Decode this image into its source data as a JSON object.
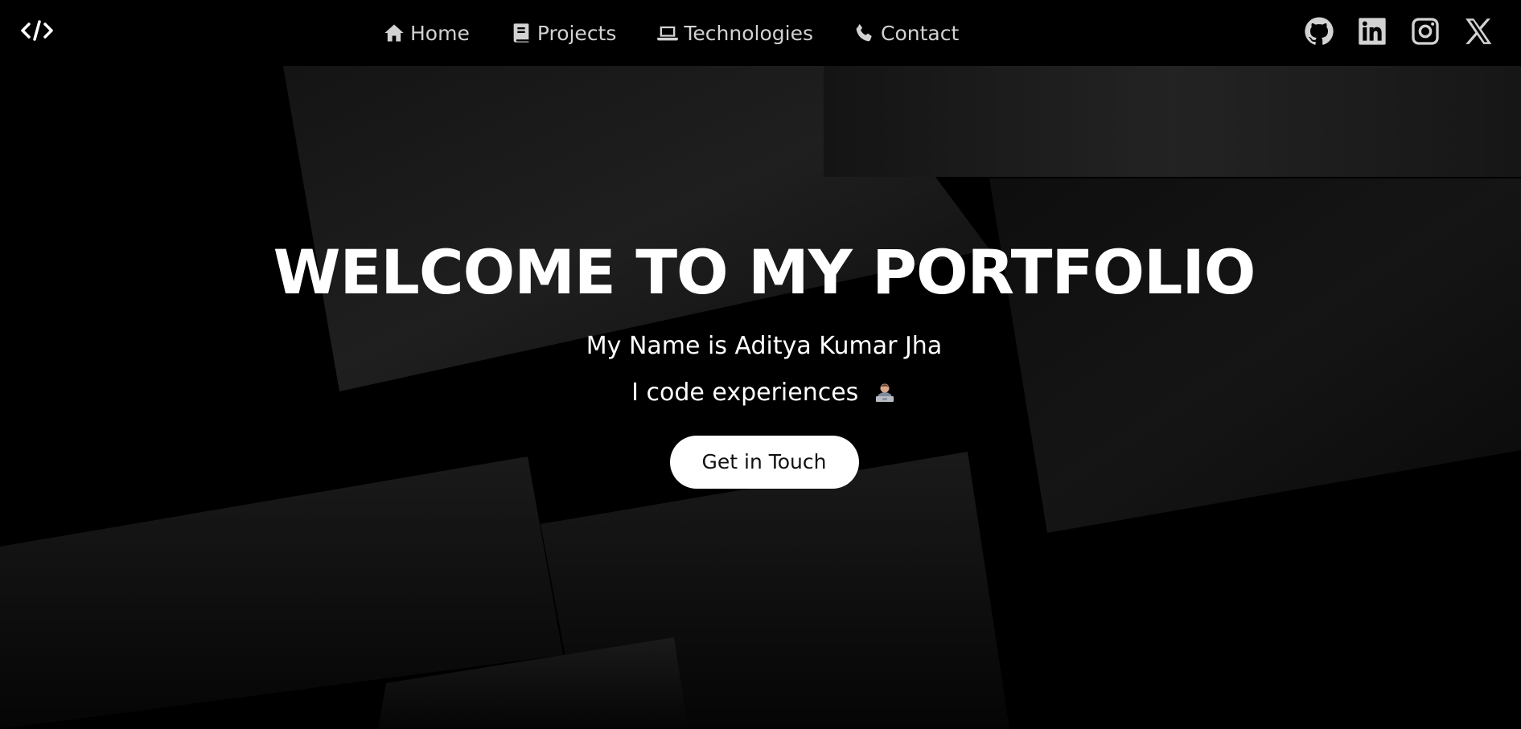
{
  "navbar": {
    "logo_icon": "code-brackets-icon",
    "links": [
      {
        "label": "Home",
        "icon": "home-icon"
      },
      {
        "label": "Projects",
        "icon": "book-icon"
      },
      {
        "label": "Technologies",
        "icon": "laptop-icon"
      },
      {
        "label": "Contact",
        "icon": "phone-icon"
      }
    ],
    "socials": [
      {
        "icon": "github-icon"
      },
      {
        "icon": "linkedin-icon"
      },
      {
        "icon": "instagram-icon"
      },
      {
        "icon": "x-icon"
      }
    ]
  },
  "hero": {
    "title": "WELCOME TO MY PORTFOLIO",
    "name_line": "My Name is Aditya Kumar Jha",
    "tagline": "I code experiences",
    "tagline_emoji": "technologist-emoji",
    "cta_label": "Get in Touch"
  },
  "colors": {
    "background": "#000000",
    "nav_text": "#d2d2d2",
    "title": "#ffffff",
    "button_bg": "#ffffff",
    "button_text": "#111111"
  }
}
